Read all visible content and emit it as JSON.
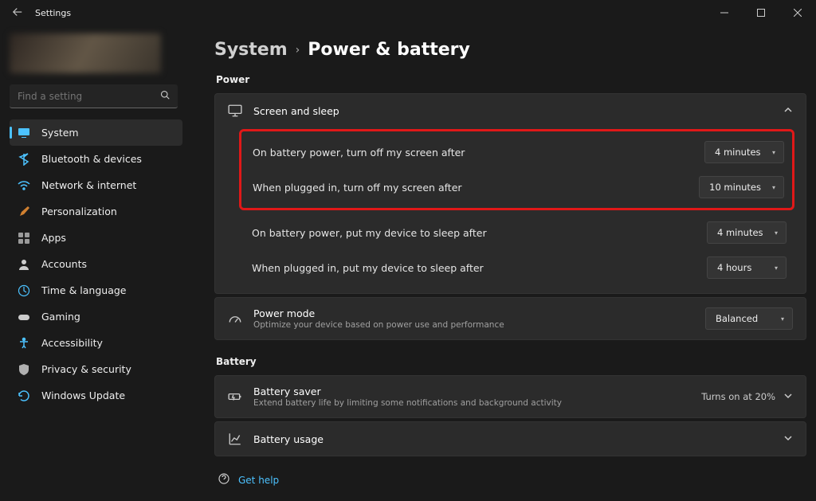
{
  "window": {
    "title": "Settings"
  },
  "search": {
    "placeholder": "Find a setting"
  },
  "nav": {
    "items": [
      {
        "label": "System"
      },
      {
        "label": "Bluetooth & devices"
      },
      {
        "label": "Network & internet"
      },
      {
        "label": "Personalization"
      },
      {
        "label": "Apps"
      },
      {
        "label": "Accounts"
      },
      {
        "label": "Time & language"
      },
      {
        "label": "Gaming"
      },
      {
        "label": "Accessibility"
      },
      {
        "label": "Privacy & security"
      },
      {
        "label": "Windows Update"
      }
    ]
  },
  "breadcrumb": {
    "parent": "System",
    "current": "Power & battery"
  },
  "sections": {
    "power": {
      "title": "Power",
      "screen_sleep": {
        "title": "Screen and sleep",
        "rows": {
          "battery_screen": {
            "label": "On battery power, turn off my screen after",
            "value": "4 minutes"
          },
          "plugged_screen": {
            "label": "When plugged in, turn off my screen after",
            "value": "10 minutes"
          },
          "battery_sleep": {
            "label": "On battery power, put my device to sleep after",
            "value": "4 minutes"
          },
          "plugged_sleep": {
            "label": "When plugged in, put my device to sleep after",
            "value": "4 hours"
          }
        }
      },
      "power_mode": {
        "title": "Power mode",
        "subtitle": "Optimize your device based on power use and performance",
        "value": "Balanced"
      }
    },
    "battery": {
      "title": "Battery",
      "saver": {
        "title": "Battery saver",
        "subtitle": "Extend battery life by limiting some notifications and background activity",
        "value": "Turns on at 20%"
      },
      "usage": {
        "title": "Battery usage"
      }
    }
  },
  "help": {
    "label": "Get help"
  }
}
